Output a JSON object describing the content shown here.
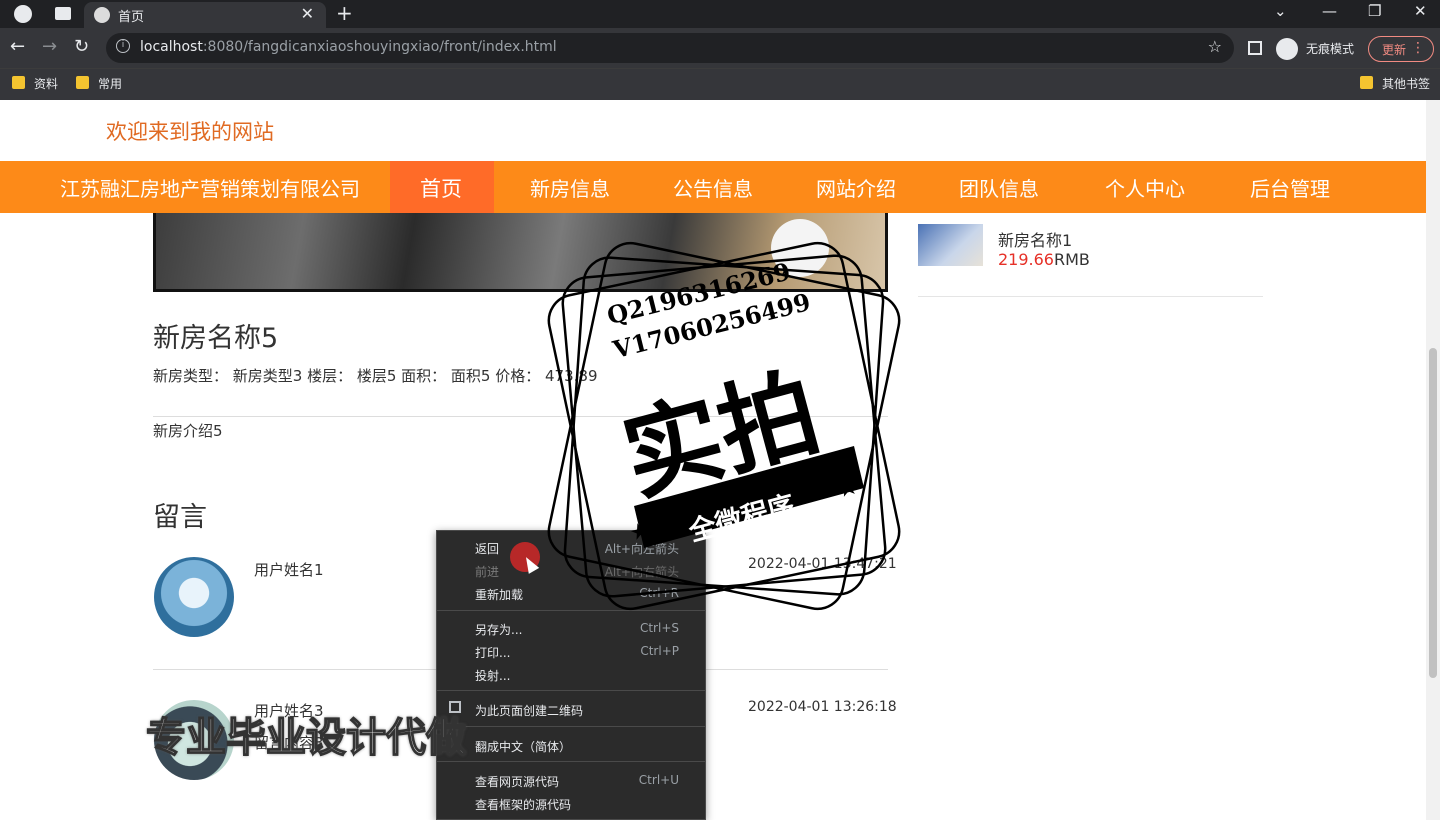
{
  "browser": {
    "tab_title": "首页",
    "url_host": "localhost",
    "url_path": ":8080/fangdicanxiaoshouyingxiao/front/index.html",
    "incognito_label": "无痕模式",
    "update_label": "更新",
    "bookmarks": [
      "资料",
      "常用"
    ],
    "other_bookmarks": "其他书签"
  },
  "site": {
    "welcome": "欢迎来到我的网站",
    "nav": [
      "江苏融汇房地产营销策划有限公司",
      "首页",
      "新房信息",
      "公告信息",
      "网站介绍",
      "团队信息",
      "个人中心",
      "后台管理"
    ],
    "title": "新房名称5",
    "meta": "新房类型：  新房类型3    楼层：  楼层5    面积：  面积5    价格：  473.89",
    "description": "新房介绍5",
    "comments_heading": "留言",
    "comments": [
      {
        "user": "用户姓名1",
        "time": "2022-04-01 13:47:21"
      },
      {
        "user": "用户姓名3",
        "content": "留言内容3",
        "time": "2022-04-01 13:26:18"
      }
    ],
    "sidebar": {
      "name": "新房名称1",
      "price": "219.66",
      "unit": "RMB"
    }
  },
  "context_menu": {
    "items": [
      {
        "label": "返回",
        "shortcut": "Alt+向左箭头"
      },
      {
        "label": "前进",
        "shortcut": "Alt+向右箭头",
        "disabled": true
      },
      {
        "label": "重新加载",
        "shortcut": "Ctrl+R"
      },
      {
        "label": "另存为...",
        "shortcut": "Ctrl+S"
      },
      {
        "label": "打印...",
        "shortcut": "Ctrl+P"
      },
      {
        "label": "投射...",
        "shortcut": ""
      },
      {
        "label": "为此页面创建二维码",
        "shortcut": ""
      },
      {
        "label": "翻成中文（简体）",
        "shortcut": ""
      },
      {
        "label": "查看网页源代码",
        "shortcut": "Ctrl+U"
      },
      {
        "label": "查看框架的源代码",
        "shortcut": ""
      }
    ]
  },
  "overlay": {
    "stamp_line1": "Q2196316269",
    "stamp_line2": "V17060256499",
    "stamp_big": "实拍",
    "stamp_ribbon": "全微程序",
    "watermark": "专业毕业设计代做"
  }
}
